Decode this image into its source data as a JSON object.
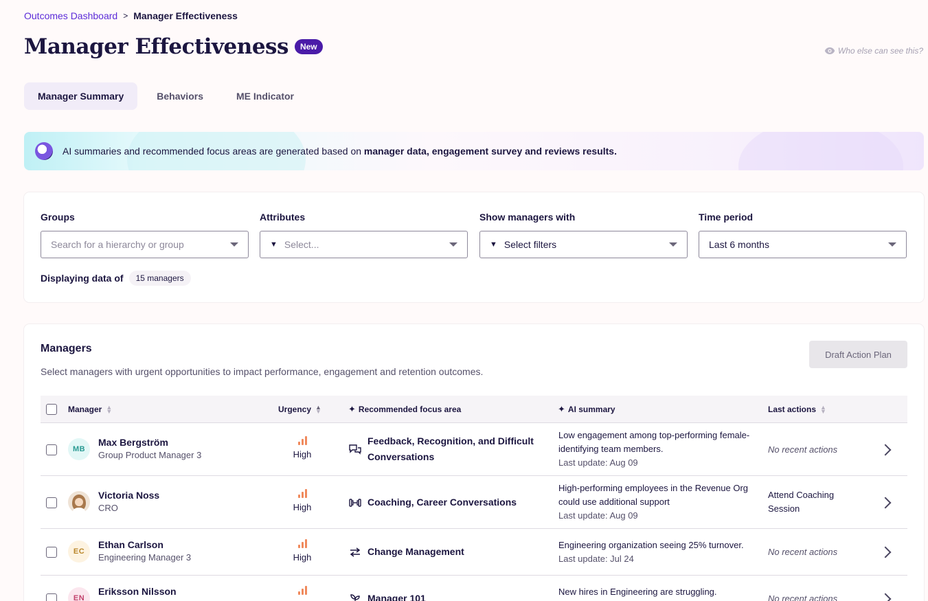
{
  "breadcrumb": {
    "parent": "Outcomes Dashboard",
    "separator": ">",
    "current": "Manager Effectiveness"
  },
  "page": {
    "title": "Manager Effectiveness",
    "badge": "New",
    "visibility_link": "Who else can see this?"
  },
  "tabs": [
    {
      "label": "Manager Summary",
      "active": true
    },
    {
      "label": "Behaviors",
      "active": false
    },
    {
      "label": "ME Indicator",
      "active": false
    }
  ],
  "banner": {
    "text_prefix": "AI summaries and recommended focus areas are generated based on ",
    "text_bold": "manager data, engagement survey and reviews results."
  },
  "filters": {
    "groups": {
      "label": "Groups",
      "placeholder": "Search for a hierarchy or group"
    },
    "attributes": {
      "label": "Attributes",
      "placeholder": "Select..."
    },
    "show_managers": {
      "label": "Show managers with",
      "placeholder": "Select filters"
    },
    "time_period": {
      "label": "Time period",
      "value": "Last 6 months"
    },
    "displaying_label": "Displaying data of",
    "count_chip": "15 managers"
  },
  "managers": {
    "title": "Managers",
    "subtitle": "Select managers with urgent opportunities to impact performance, engagement and retention outcomes.",
    "draft_button": "Draft Action Plan",
    "columns": {
      "manager": "Manager",
      "urgency": "Urgency",
      "focus": "Recommended focus area",
      "summary": "AI summary",
      "last_actions": "Last actions"
    },
    "rows": [
      {
        "initials": "MB",
        "avatar_bg": "#e2f7f6",
        "avatar_fg": "#2a9a93",
        "name": "Max Bergström",
        "role": "Group Product Manager 3",
        "urgency": "High",
        "focus_line1": "Feedback, Recognition, and Difficult",
        "focus_line2": "Conversations",
        "focus_icon": "chat-bubbles-icon",
        "summary_line1": "Low engagement among top-performing female-",
        "summary_line2": "identifying team members.",
        "updated": "Last update: Aug 09",
        "last_line1": "No recent actions",
        "last_line2": "",
        "no_actions": true
      },
      {
        "initials": "",
        "avatar_bg": "#f3dcc7",
        "avatar_fg": "#7a4a2a",
        "name": "Victoria Noss",
        "role": "CRO",
        "urgency": "High",
        "focus_line1": "Coaching, Career Conversations",
        "focus_line2": "",
        "focus_icon": "dumbbell-icon",
        "summary_line1": "High-performing employees in the Revenue Org",
        "summary_line2": "could use additional support",
        "updated": "Last update: Aug 09",
        "last_line1": "Attend Coaching",
        "last_line2": "Session",
        "no_actions": false
      },
      {
        "initials": "EC",
        "avatar_bg": "#fdf3e1",
        "avatar_fg": "#b9862a",
        "name": "Ethan Carlson",
        "role": "Engineering Manager 3",
        "urgency": "High",
        "focus_line1": "Change Management",
        "focus_line2": "",
        "focus_icon": "swap-arrows-icon",
        "summary_line1": "Engineering organization seeing 25% turnover.",
        "summary_line2": "",
        "updated": "Last update: Jul 24",
        "last_line1": "No recent actions",
        "last_line2": "",
        "no_actions": true
      },
      {
        "initials": "EN",
        "avatar_bg": "#fbe6ee",
        "avatar_fg": "#c2426d",
        "name": "Eriksson Nilsson",
        "role": "",
        "urgency": "High",
        "focus_line1": "Manager 101",
        "focus_line2": "",
        "focus_icon": "sprout-icon",
        "summary_line1": "New hires in Engineering are struggling.",
        "summary_line2": "",
        "updated": "",
        "last_line1": "No recent actions",
        "last_line2": "",
        "no_actions": true
      }
    ]
  }
}
